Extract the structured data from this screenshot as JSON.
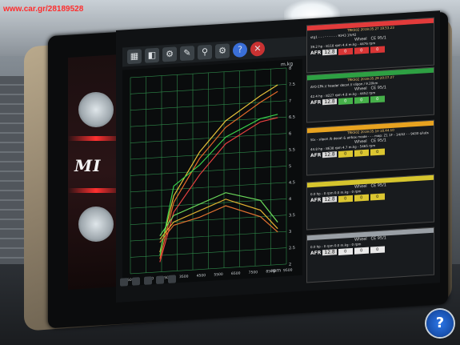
{
  "watermark": "www.car.gr/28189528",
  "logo_text": "MI",
  "plot": {
    "y_unit": "m.kg",
    "x_unit": "rpm",
    "y_ticks": [
      "8",
      "7.5",
      "7",
      "6.5",
      "6",
      "5.5",
      "5",
      "4.5",
      "4",
      "3.5",
      "3",
      "2.5",
      "2"
    ],
    "x_ticks": [
      "500",
      "1500",
      "2500",
      "3500",
      "4500",
      "5500",
      "6500",
      "7500",
      "8500",
      "9500"
    ],
    "series": [
      {
        "color": "#e8c23a",
        "points": [
          [
            2200,
            2.6
          ],
          [
            3000,
            4.3
          ],
          [
            4500,
            5.6
          ],
          [
            6000,
            6.5
          ],
          [
            8000,
            7.2
          ],
          [
            9000,
            7.5
          ]
        ]
      },
      {
        "color": "#e86a2a",
        "points": [
          [
            2200,
            2.4
          ],
          [
            3000,
            4.1
          ],
          [
            4500,
            5.4
          ],
          [
            6000,
            6.3
          ],
          [
            8000,
            7.0
          ],
          [
            9000,
            7.3
          ]
        ]
      },
      {
        "color": "#e84040",
        "points": [
          [
            2200,
            2.3
          ],
          [
            3000,
            3.8
          ],
          [
            4500,
            4.9
          ],
          [
            6000,
            5.8
          ],
          [
            8000,
            6.4
          ],
          [
            9000,
            6.5
          ]
        ]
      },
      {
        "color": "#39d14a",
        "points": [
          [
            2200,
            2.5
          ],
          [
            3000,
            4.6
          ],
          [
            4500,
            5.2
          ],
          [
            6000,
            6.0
          ],
          [
            8000,
            6.5
          ],
          [
            9000,
            6.6
          ]
        ]
      },
      {
        "color": "#6ad85a",
        "points": [
          [
            2200,
            3.1
          ],
          [
            3000,
            3.7
          ],
          [
            4500,
            4.0
          ],
          [
            6000,
            4.3
          ],
          [
            8000,
            4.0
          ],
          [
            9000,
            3.3
          ]
        ]
      },
      {
        "color": "#e0b030",
        "points": [
          [
            2200,
            3.0
          ],
          [
            3000,
            3.5
          ],
          [
            4500,
            3.8
          ],
          [
            6000,
            4.1
          ],
          [
            8000,
            3.7
          ],
          [
            9000,
            3.1
          ]
        ]
      },
      {
        "color": "#e07030",
        "points": [
          [
            2200,
            2.9
          ],
          [
            3000,
            3.4
          ],
          [
            4500,
            3.6
          ],
          [
            6000,
            3.9
          ],
          [
            8000,
            3.5
          ],
          [
            9000,
            3.0
          ]
        ]
      }
    ]
  },
  "cards": [
    {
      "color": "#e23b3b",
      "title": "TRK502   2019.05.27 19.53.23",
      "info": "stg1 - - - - - - - - - 9343  15/42",
      "wheel": "Wheel",
      "ce": "CE 95/1",
      "perf": "39.2 hp - 8118 rpm    4.4 m.kg - 4476 rpm",
      "afr": "12.8",
      "cells": [
        "0",
        "0",
        "0"
      ],
      "cellClass": "red"
    },
    {
      "color": "#2ea043",
      "title": "TRK502   2019.05.29 20.07.27",
      "info": "AYO EPA // header decat // slipon / 9.20km",
      "wheel": "Wheel",
      "ce": "CE 95/1",
      "perf": "42.4 hp - 8227 rpm    4.8 m.kg - 4452 rpm",
      "afr": "12.8",
      "cells": [
        "0",
        "0",
        "0"
      ],
      "cellClass": "green"
    },
    {
      "color": "#e8a320",
      "title": "TRK502   2019.05.10 18.44.10",
      "info": "Stx - slipon /b decat & airbox mode - - -  map: Z1 1F - 14/42 - - 9430 αλιάκ",
      "wheel": "Wheel",
      "ce": "CE 95/1",
      "perf": "44.8 hp - 8638 rpm    4.7 m.kg - 5465 rpm",
      "afr": "12.8",
      "cells": [
        "0",
        "0",
        "0"
      ],
      "cellClass": "yellow"
    },
    {
      "color": "#d6c52e",
      "title": "",
      "info": "",
      "wheel": "Wheel",
      "ce": "CE 95/1",
      "perf": "0.0 hp - 0 rpm    0.0 m.kg - 0 rpm",
      "afr": "12.8",
      "cells": [
        "0",
        "0",
        "0"
      ],
      "cellClass": "yellow"
    },
    {
      "color": "#9aa0a6",
      "title": "",
      "info": "",
      "wheel": "Wheel",
      "ce": "CE 95/1",
      "perf": "0.0 hp - 0 rpm    0.0 m.kg - 0 rpm",
      "afr": "12.8",
      "cells": [
        "0",
        "0",
        "0"
      ],
      "cellClass": ""
    }
  ],
  "help_label": "?"
}
